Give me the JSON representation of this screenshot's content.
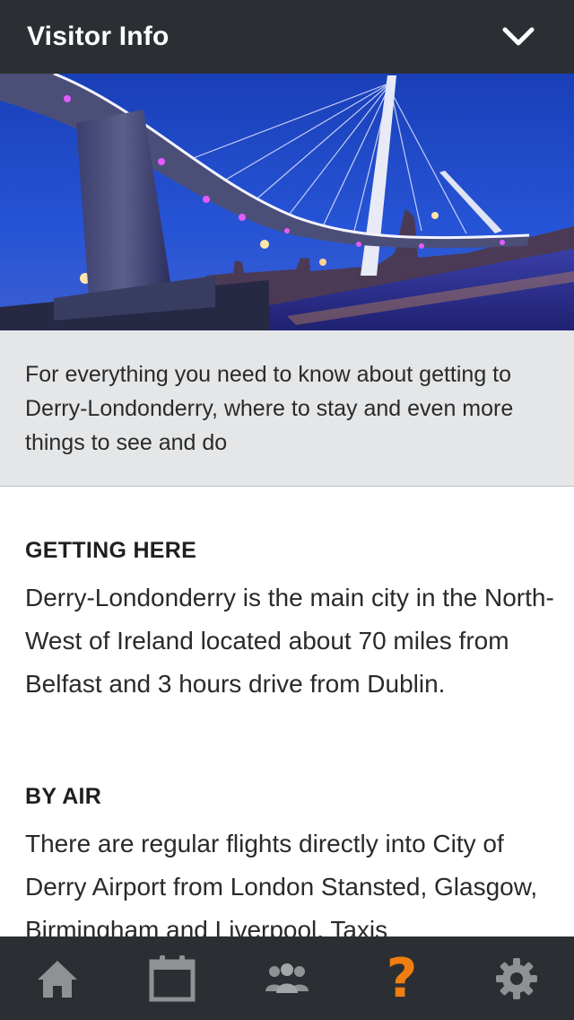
{
  "header": {
    "title": "Visitor Info",
    "toggle_icon": "chevron-down-icon"
  },
  "hero": {
    "image_subject": "illuminated-bridge-photo"
  },
  "intro": {
    "text": "For everything you need to know about getting to Derry-Londonderry, where to stay and even more things to see and do"
  },
  "sections": [
    {
      "heading": "GETTING HERE",
      "body": "Derry-Londonderry is the main city in the North-West of Ireland located about 70 miles from Belfast and 3 hours drive from Dublin."
    },
    {
      "heading": "BY AIR",
      "body": "There are regular flights directly into City of Derry Airport from London Stansted, Glasgow, Birmingham and Liverpool. Taxis"
    }
  ],
  "tabbar": {
    "items": [
      {
        "icon": "home-icon",
        "active": false
      },
      {
        "icon": "calendar-icon",
        "active": false
      },
      {
        "icon": "people-icon",
        "active": false
      },
      {
        "icon": "question-icon",
        "label": "?",
        "active": true
      },
      {
        "icon": "gear-icon",
        "active": false
      }
    ],
    "active_color": "#f07d12",
    "icon_color": "#8f9294"
  },
  "colors": {
    "bar_background": "#2b2f33",
    "intro_background": "#e4e6e8"
  }
}
